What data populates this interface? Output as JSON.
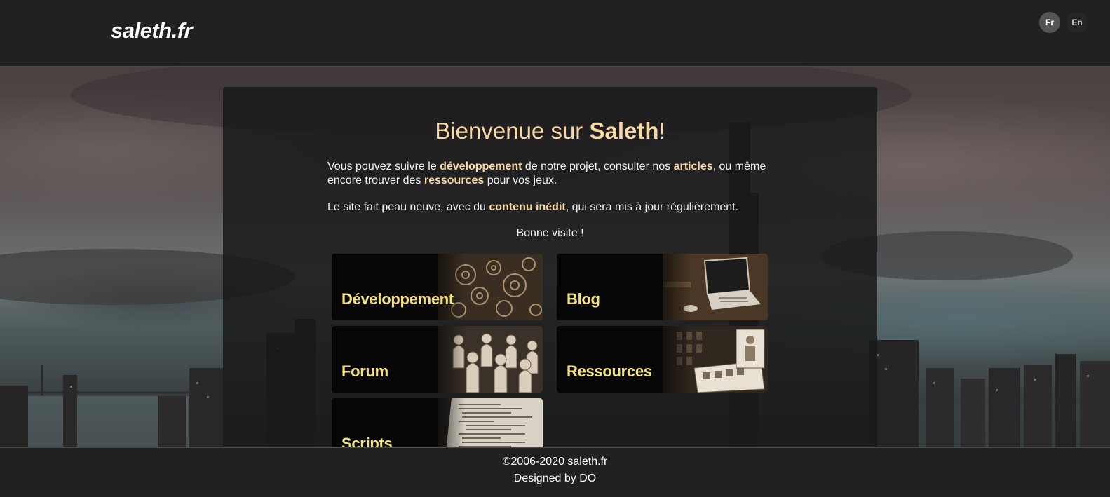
{
  "header": {
    "logo": "saleth.fr",
    "languages": [
      {
        "label": "Fr",
        "active": true
      },
      {
        "label": "En",
        "active": false
      }
    ]
  },
  "welcome": {
    "title_prefix": "Bienvenue sur ",
    "title_name": "Saleth",
    "title_suffix": "!",
    "p1": {
      "t1": "Vous pouvez suivre le ",
      "h1": "développement",
      "t2": " de notre projet, consulter nos ",
      "h2": "articles",
      "t3": ", ou même encore trouver des ",
      "h3": "ressources",
      "t4": " pour vos jeux."
    },
    "p2": {
      "t1": "Le site fait peau neuve, avec du ",
      "h1": "contenu inédit",
      "t2": ", qui sera mis à jour régulièrement."
    },
    "closing": "Bonne visite !"
  },
  "cards": [
    {
      "label": "Développement",
      "icon": "gears-image"
    },
    {
      "label": "Blog",
      "icon": "laptop-image"
    },
    {
      "label": "Forum",
      "icon": "pawns-image"
    },
    {
      "label": "Ressources",
      "icon": "game-cards-image"
    },
    {
      "label": "Scripts",
      "icon": "code-screen-image"
    }
  ],
  "footer": {
    "copyright": "©2006-2020 saleth.fr",
    "designer": "Designed by DO"
  },
  "colors": {
    "accent": "#f7d9a6",
    "card_label": "#f5e27a",
    "bar_background": "#212121"
  }
}
